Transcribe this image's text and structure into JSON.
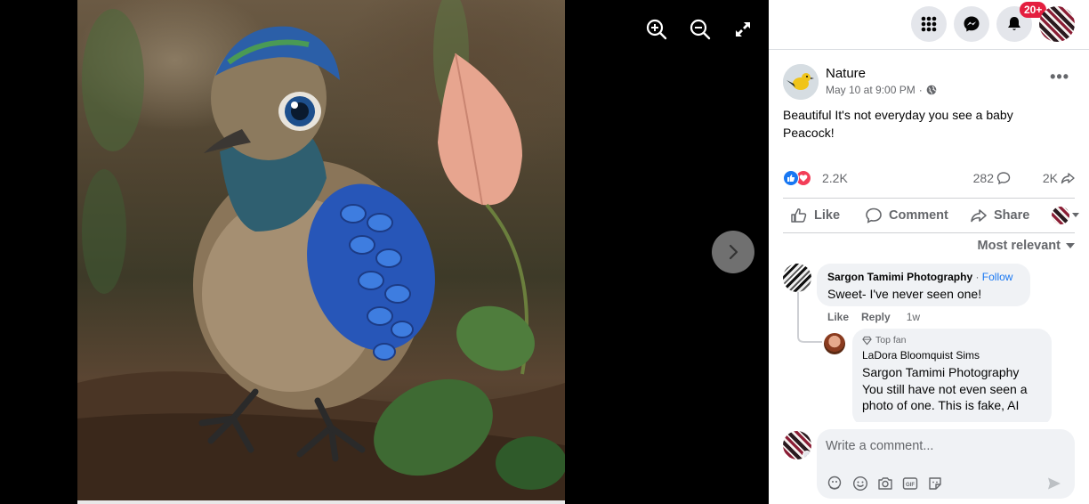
{
  "viewer": {
    "zoom_in_icon": "zoom-in-icon",
    "zoom_out_icon": "zoom-out-icon",
    "fullscreen_icon": "expand-icon",
    "next_icon": "chevron-right-icon"
  },
  "topbar": {
    "notifications_badge": "20+"
  },
  "post": {
    "page_name": "Nature",
    "timestamp": "May 10 at 9:00 PM",
    "separator": "·",
    "text": "Beautiful It's not everyday you see a baby Peacock!",
    "reaction_count": "2.2K",
    "comment_count": "282",
    "share_count": "2K"
  },
  "actions": {
    "like": "Like",
    "comment": "Comment",
    "share": "Share"
  },
  "comments": {
    "sort_label": "Most relevant",
    "first": {
      "author": "Sargon Tamimi Photography",
      "follow": "Follow",
      "dot": " · ",
      "text": "Sweet- I've never seen one!",
      "like": "Like",
      "reply": "Reply",
      "age": "1w"
    },
    "reply": {
      "badge": "Top fan",
      "author": "LaDora Bloomquist Sims",
      "mention": "Sargon Tamimi Photography",
      "text": "You still have not even seen a photo of one. This is fake, AI"
    },
    "input_placeholder": "Write a comment..."
  },
  "colors": {
    "accent": "#1877f2",
    "badge": "#e41e3f",
    "love": "#f33e58"
  }
}
